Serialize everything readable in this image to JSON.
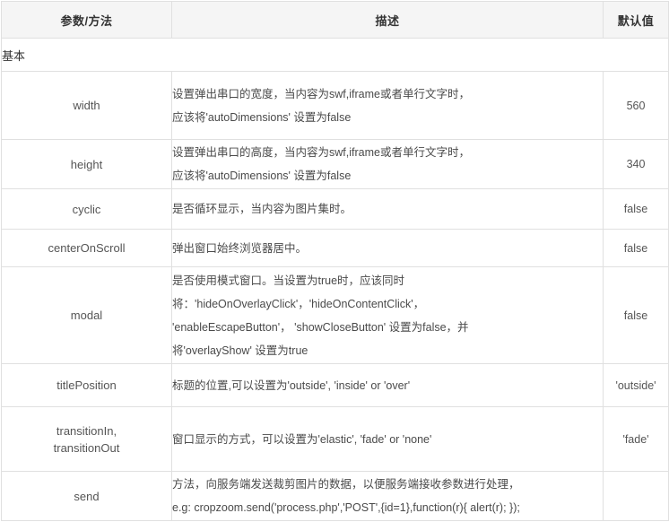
{
  "table": {
    "headers": {
      "param": "参数/方法",
      "description": "描述",
      "default": "默认值"
    },
    "groups": [
      {
        "label": "基本"
      }
    ],
    "rows": [
      {
        "name_lines": [
          "width"
        ],
        "desc_lines": [
          "设置弹出串口的宽度，当内容为swf,iframe或者单行文字时，",
          "应该将'autoDimensions' 设置为false"
        ],
        "default": "560"
      },
      {
        "name_lines": [
          "height"
        ],
        "desc_lines": [
          "设置弹出串口的高度，当内容为swf,iframe或者单行文字时，",
          "应该将'autoDimensions' 设置为false"
        ],
        "default": "340"
      },
      {
        "name_lines": [
          "cyclic"
        ],
        "desc_lines": [
          "是否循环显示，当内容为图片集时。"
        ],
        "default": "false"
      },
      {
        "name_lines": [
          "centerOnScroll"
        ],
        "desc_lines": [
          "弹出窗口始终浏览器居中。"
        ],
        "default": "false"
      },
      {
        "name_lines": [
          "modal"
        ],
        "desc_lines": [
          "是否使用模式窗口。当设置为true时，应该同时",
          "将：'hideOnOverlayClick'，'hideOnContentClick'，",
          "'enableEscapeButton'， 'showCloseButton' 设置为false，并",
          "将'overlayShow' 设置为true"
        ],
        "default": "false"
      },
      {
        "name_lines": [
          "titlePosition"
        ],
        "desc_lines": [
          "标题的位置,可以设置为'outside', 'inside' or 'over'"
        ],
        "default": "'outside'"
      },
      {
        "name_lines": [
          "transitionIn,",
          "transitionOut"
        ],
        "desc_lines": [
          "窗口显示的方式，可以设置为'elastic', 'fade' or 'none'"
        ],
        "default": "'fade'"
      },
      {
        "name_lines": [
          "send"
        ],
        "desc_lines": [
          "方法，向服务端发送裁剪图片的数据，以便服务端接收参数进行处理，",
          "e.g: cropzoom.send('process.php','POST',{id=1},function(r){ alert(r); });"
        ],
        "default": ""
      }
    ]
  },
  "colors": {
    "border": "#e0e0e0",
    "header_bg": "#f5f5f5",
    "text": "#4a4a4a",
    "heading_text": "#333333"
  }
}
